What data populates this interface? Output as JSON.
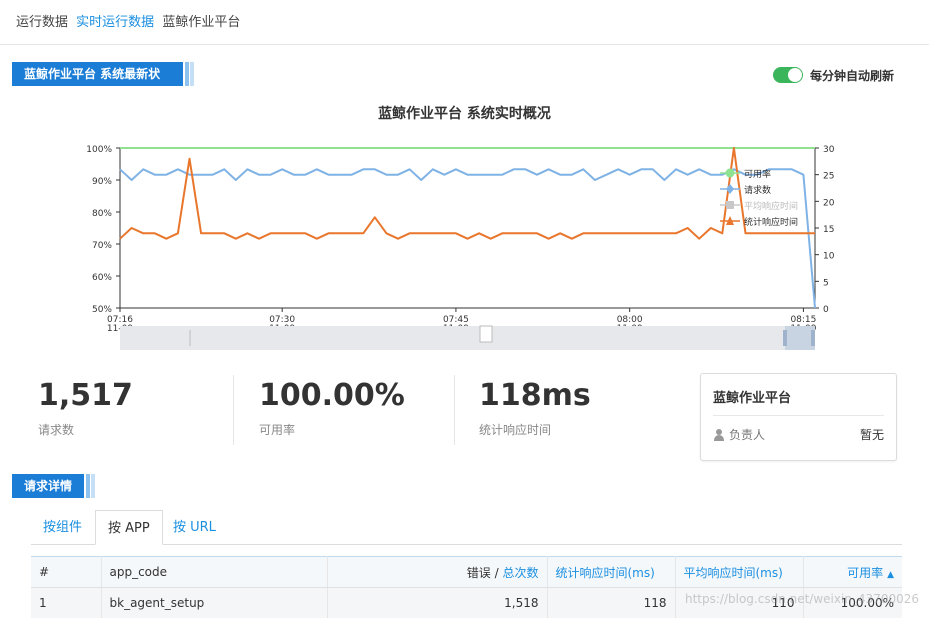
{
  "breadcrumb": {
    "root": "运行数据",
    "link": "实时运行数据",
    "current": "蓝鲸作业平台"
  },
  "status_section": {
    "title": "蓝鲸作业平台 系统最新状态",
    "auto_refresh_label": "每分钟自动刷新",
    "auto_refresh_on": true
  },
  "chart_data": {
    "type": "line",
    "title": "蓝鲸作业平台 系统实时概况",
    "x": [
      "07:16",
      "07:17",
      "07:18",
      "07:19",
      "07:20",
      "07:21",
      "07:22",
      "07:23",
      "07:24",
      "07:25",
      "07:26",
      "07:27",
      "07:28",
      "07:29",
      "07:30",
      "07:31",
      "07:32",
      "07:33",
      "07:34",
      "07:35",
      "07:36",
      "07:37",
      "07:38",
      "07:39",
      "07:40",
      "07:41",
      "07:42",
      "07:43",
      "07:44",
      "07:45",
      "07:46",
      "07:47",
      "07:48",
      "07:49",
      "07:50",
      "07:51",
      "07:52",
      "07:53",
      "07:54",
      "07:55",
      "07:56",
      "07:57",
      "07:58",
      "07:59",
      "08:00",
      "08:01",
      "08:02",
      "08:03",
      "08:04",
      "08:05",
      "08:06",
      "08:07",
      "08:08",
      "08:09",
      "08:10",
      "08:11",
      "08:12",
      "08:13",
      "08:14",
      "08:15",
      "08:16"
    ],
    "x_tick_labels": [
      {
        "time": "07:16",
        "date": "11-09"
      },
      {
        "time": "07:30",
        "date": "11-09"
      },
      {
        "time": "07:45",
        "date": "11-09"
      },
      {
        "time": "08:00",
        "date": "11-09"
      },
      {
        "time": "08:15",
        "date": "11-09"
      }
    ],
    "y_left": {
      "ticks": [
        "100%",
        "90%",
        "80%",
        "70%",
        "60%",
        "50%"
      ],
      "range": [
        50,
        100
      ]
    },
    "y_right": {
      "ticks": [
        "30",
        "25",
        "20",
        "15",
        "10",
        "5",
        "0"
      ],
      "range": [
        0,
        30
      ]
    },
    "legend": [
      "可用率",
      "请求数",
      "平均响应时间",
      "统计响应时间"
    ],
    "legend_position": "right",
    "series": [
      {
        "name": "可用率",
        "axis": "left",
        "color": "#8fe28f",
        "values": [
          100,
          100,
          100,
          100,
          100,
          100,
          100,
          100,
          100,
          100,
          100,
          100,
          100,
          100,
          100,
          100,
          100,
          100,
          100,
          100,
          100,
          100,
          100,
          100,
          100,
          100,
          100,
          100,
          100,
          100,
          100,
          100,
          100,
          100,
          100,
          100,
          100,
          100,
          100,
          100,
          100,
          100,
          100,
          100,
          100,
          100,
          100,
          100,
          100,
          100,
          100,
          100,
          100,
          100,
          100,
          100,
          100,
          100,
          100,
          100,
          100
        ]
      },
      {
        "name": "请求数",
        "axis": "right",
        "color": "#7fb2e5",
        "values": [
          26,
          24,
          26,
          25,
          25,
          26,
          25,
          25,
          25,
          26,
          24,
          26,
          25,
          25,
          26,
          25,
          25,
          26,
          25,
          25,
          25,
          26,
          26,
          25,
          25,
          26,
          24,
          26,
          25,
          26,
          25,
          25,
          25,
          25,
          26,
          26,
          25,
          26,
          25,
          25,
          26,
          24,
          25,
          26,
          25,
          26,
          26,
          24,
          26,
          25,
          26,
          25,
          25,
          26,
          25,
          25,
          26,
          26,
          26,
          25,
          0
        ]
      },
      {
        "name": "平均响应时间",
        "axis": "right",
        "color": "#c8c8c8",
        "values": []
      },
      {
        "name": "统计响应时间",
        "axis": "right",
        "color": "#e8762c",
        "values": [
          13,
          15,
          14,
          14,
          13,
          14,
          28,
          14,
          14,
          14,
          13,
          14,
          13,
          14,
          14,
          14,
          14,
          13,
          14,
          14,
          14,
          14,
          17,
          14,
          13,
          14,
          14,
          14,
          14,
          14,
          13,
          14,
          13,
          14,
          14,
          14,
          14,
          13,
          14,
          13,
          14,
          14,
          14,
          14,
          14,
          14,
          14,
          14,
          14,
          15,
          13,
          15,
          14,
          30,
          14,
          14,
          14,
          14,
          14,
          14,
          14
        ]
      }
    ],
    "grid": false
  },
  "stats": [
    {
      "value": "1,517",
      "label": "请求数"
    },
    {
      "value": "100.00%",
      "label": "可用率"
    },
    {
      "value": "118ms",
      "label": "统计响应时间"
    }
  ],
  "owner_card": {
    "title": "蓝鲸作业平台",
    "owner_key": "负责人",
    "owner_value": "暂无"
  },
  "details_section": {
    "title": "请求详情"
  },
  "tabs": [
    {
      "label": "按组件",
      "active": false
    },
    {
      "label": "按 APP",
      "active": true
    },
    {
      "label": "按 URL",
      "active": false
    }
  ],
  "table": {
    "headers": {
      "index": "#",
      "app_code": "app_code",
      "errors": "错误",
      "slash": " / ",
      "total": "总次数",
      "stat_resp": "统计响应时间(ms)",
      "avg_resp": "平均响应时间(ms)",
      "availability": "可用率"
    },
    "rows": [
      {
        "index": "1",
        "app_code": "bk_agent_setup",
        "total": "1,518",
        "stat_resp": "118",
        "avg_resp": "110",
        "availability": "100.00%"
      }
    ]
  },
  "watermark": "https://blog.csdn.net/weixin_43700026"
}
